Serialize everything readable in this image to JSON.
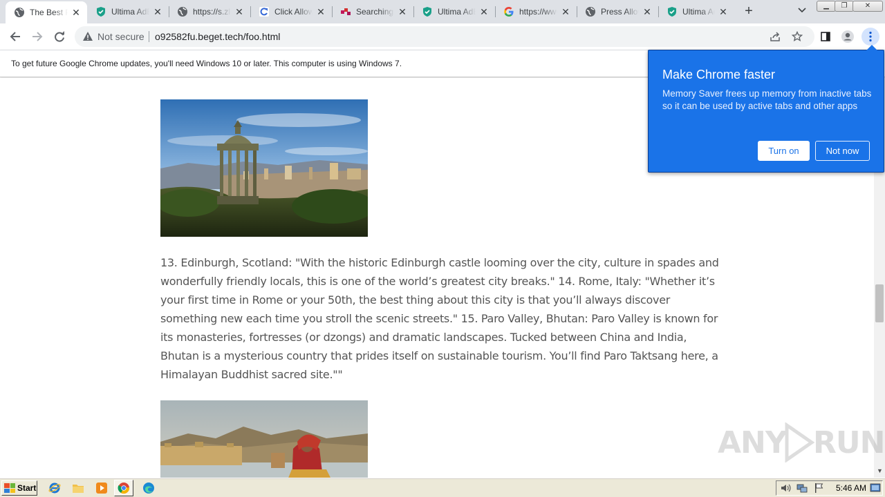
{
  "tabs": [
    {
      "title": "The Best Places",
      "icon": "globe-icon",
      "active": true
    },
    {
      "title": "Ultima AdBlocker",
      "icon": "shield-icon"
    },
    {
      "title": "https://s.zlink",
      "icon": "globe-icon"
    },
    {
      "title": "Click Allow",
      "icon": "refresh-c-icon"
    },
    {
      "title": "Searching for",
      "icon": "dots-icon"
    },
    {
      "title": "Ultima AdBlocker",
      "icon": "shield-icon"
    },
    {
      "title": "https://www.google",
      "icon": "google-icon"
    },
    {
      "title": "Press Allow",
      "icon": "globe-icon"
    },
    {
      "title": "Ultima AdBlocker",
      "icon": "shield-icon"
    }
  ],
  "toolbar": {
    "security_label": "Not secure",
    "url": "o92582fu.beget.tech/foo.html"
  },
  "infobar": {
    "message": "To get future Google Chrome updates, you'll need Windows 10 or later. This computer is using Windows 7."
  },
  "article": {
    "paragraph": "13. Edinburgh, Scotland: \"With the historic Edinburgh castle looming over the city, culture in spades and wonderfully friendly locals, this is one of the world’s greatest city breaks.\" 14. Rome, Italy: \"Whether it’s your first time in Rome or your 50th, the best thing about this city is that you’ll always discover something new each time you stroll the scenic streets.\" 15. Paro Valley, Bhutan: Paro Valley is known for its monasteries, fortresses (or dzongs) and dramatic landscapes. Tucked between China and India, Bhutan is a mysterious country that prides itself on sustainable tourism. You’ll find Paro Taktsang here, a Himalayan Buddhist sacred site.\"\""
  },
  "popup": {
    "title": "Make Chrome faster",
    "body": "Memory Saver frees up memory from inactive tabs so it can be used by active tabs and other apps",
    "turn_on_label": "Turn on",
    "not_now_label": "Not now"
  },
  "watermark": {
    "left": "ANY",
    "right": "RUN"
  },
  "taskbar": {
    "start_label": "Start",
    "clock": "5:46 AM"
  },
  "colors": {
    "popup_bg": "#1a73e8",
    "tabstrip_bg": "#dee1e6",
    "taskbar_bg": "#ece9d8"
  }
}
